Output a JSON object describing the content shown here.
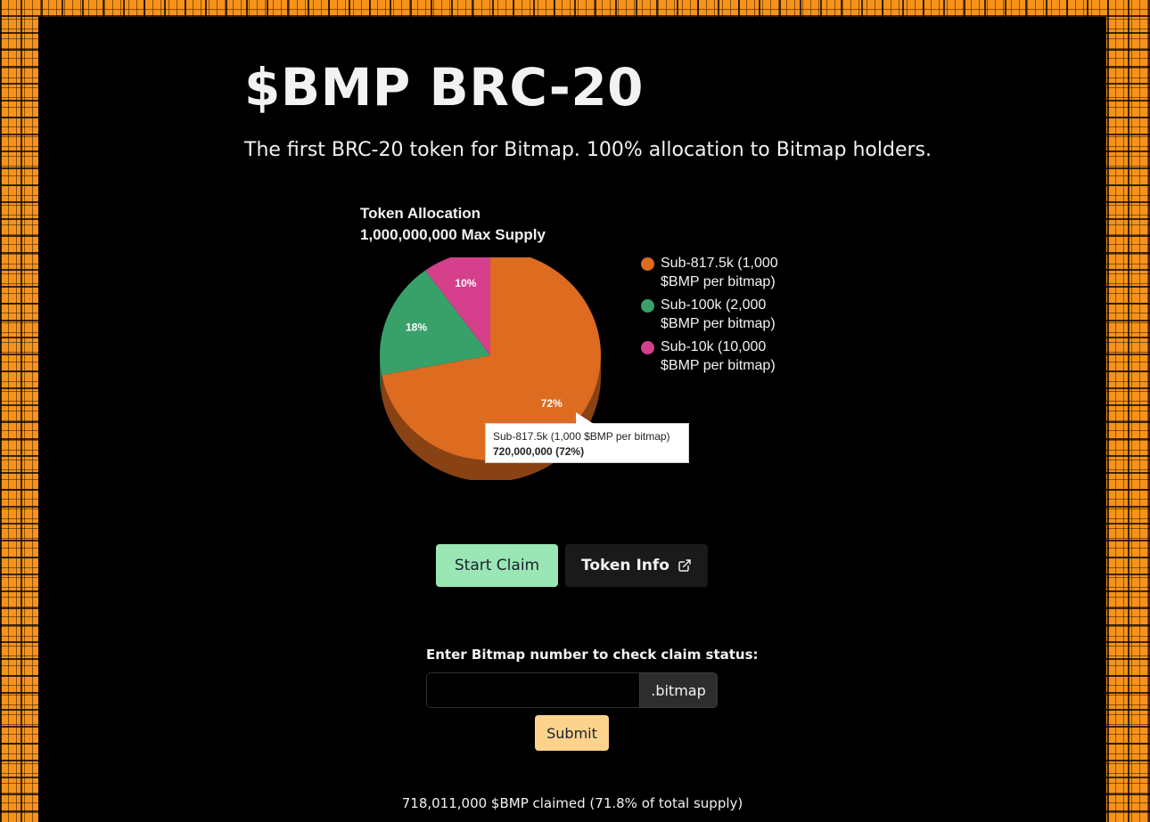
{
  "header": {
    "title": "$BMP BRC-20",
    "subtitle": "The first BRC-20 token for Bitmap. 100% allocation to Bitmap holders."
  },
  "chart_data": {
    "type": "pie",
    "title": "Token Allocation",
    "subtitle": "1,000,000,000 Max Supply",
    "categories": [
      "Sub-817.5k (1,000 $BMP per bitmap)",
      "Sub-100k (2,000 $BMP per bitmap)",
      "Sub-10k (10,000 $BMP per bitmap)"
    ],
    "values": [
      720000000,
      180000000,
      100000000
    ],
    "percent_labels": [
      "72%",
      "18%",
      "10%"
    ],
    "colors": [
      "#dd6b20",
      "#38a169",
      "#d53f8c"
    ],
    "legend_position": "right",
    "three_d": true,
    "tooltip": {
      "series": "Sub-817.5k (1,000 $BMP per bitmap)",
      "value": "720,000,000 (72%)"
    }
  },
  "actions": {
    "start_claim": "Start Claim",
    "token_info": "Token Info",
    "token_info_icon": "external-link-icon"
  },
  "claim_check": {
    "label": "Enter Bitmap number to check claim status:",
    "input_value": "",
    "addon": ".bitmap",
    "submit": "Submit"
  },
  "status": {
    "claimed": "718,011,000 $BMP claimed (71.8% of total supply)"
  }
}
